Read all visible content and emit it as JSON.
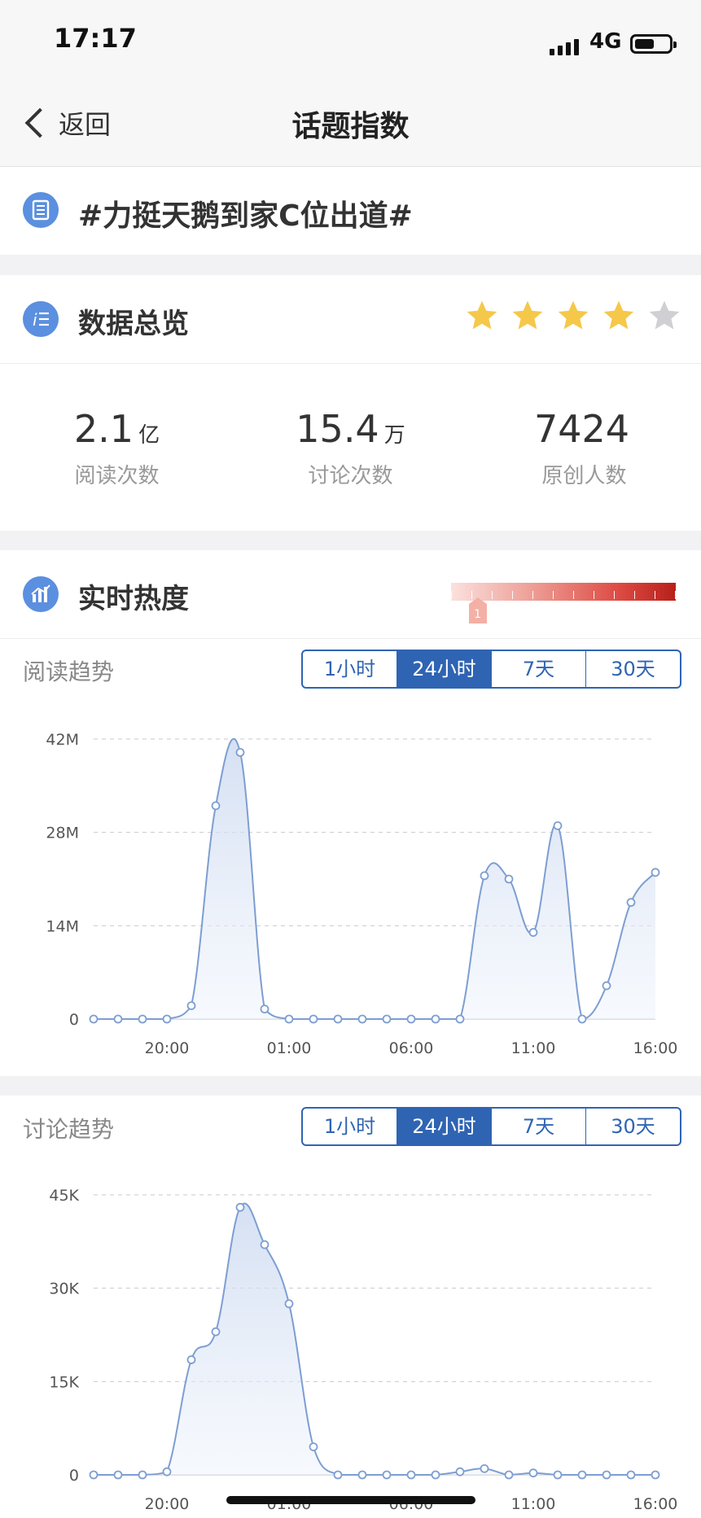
{
  "status_bar": {
    "time": "17:17",
    "network": "4G",
    "battery_percent": 60
  },
  "nav": {
    "back_label": "返回",
    "title": "话题指数"
  },
  "topic": {
    "icon": "list-doc-icon",
    "name": "#力挺天鹅到家C位出道#"
  },
  "overview": {
    "icon": "list-icon",
    "title": "数据总览",
    "rating": 4,
    "rating_max": 5,
    "stats": [
      {
        "value": "2.1",
        "unit": "亿",
        "label": "阅读次数"
      },
      {
        "value": "15.4",
        "unit": "万",
        "label": "讨论次数"
      },
      {
        "value": "7424",
        "unit": "",
        "label": "原创人数"
      }
    ]
  },
  "heat": {
    "icon": "bar-chart-icon",
    "title": "实时热度",
    "level": "1",
    "level_fraction": 0.1
  },
  "tabs": [
    "1小时",
    "24小时",
    "7天",
    "30天"
  ],
  "active_tab": 1,
  "colors": {
    "accent": "#2f64b3",
    "star_on": "#f5c84a",
    "star_off": "#d0d0d4",
    "line": "#7d9ed2"
  },
  "chart_data": [
    {
      "type": "line",
      "title": "阅读趋势",
      "x_ticks": [
        "20:00",
        "01:00",
        "06:00",
        "11:00",
        "16:00"
      ],
      "y_ticks": [
        "0",
        "14M",
        "28M",
        "42M"
      ],
      "ylim": [
        0,
        42
      ],
      "y_unit": "M",
      "values": [
        0,
        0,
        0,
        0,
        2,
        32,
        40,
        1.5,
        0,
        0,
        0,
        0,
        0,
        0,
        0,
        0,
        21.5,
        21,
        13,
        29,
        0,
        5,
        17.5,
        22
      ]
    },
    {
      "type": "line",
      "title": "讨论趋势",
      "x_ticks": [
        "20:00",
        "01:00",
        "06:00",
        "11:00",
        "16:00"
      ],
      "y_ticks": [
        "0",
        "15K",
        "30K",
        "45K"
      ],
      "ylim": [
        0,
        45
      ],
      "y_unit": "K",
      "values": [
        0,
        0,
        0,
        0.5,
        18.5,
        23,
        43,
        37,
        27.5,
        4.5,
        0,
        0,
        0,
        0,
        0,
        0.5,
        1,
        0,
        0.3,
        0,
        0,
        0,
        0,
        0
      ]
    }
  ]
}
